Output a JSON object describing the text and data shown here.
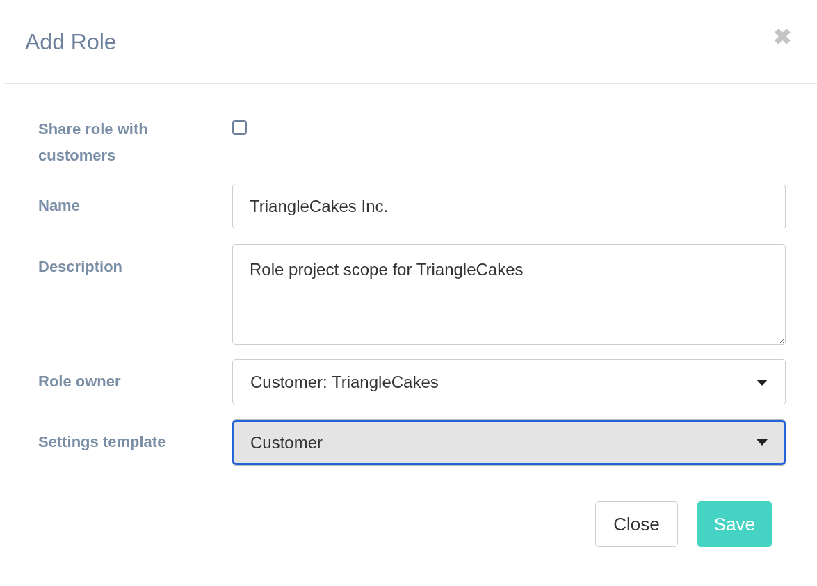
{
  "dialog": {
    "title": "Add Role",
    "close_icon": "✖"
  },
  "fields": [
    {
      "kind": "checkbox",
      "label": "Share role with customers",
      "checked": false
    },
    {
      "kind": "text",
      "label": "Name",
      "value": "TriangleCakes Inc."
    },
    {
      "kind": "textarea",
      "label": "Description",
      "value": "Role project scope for TriangleCakes"
    },
    {
      "kind": "select",
      "label": "Role owner",
      "value": "Customer: TriangleCakes",
      "focused": false
    },
    {
      "kind": "select",
      "label": "Settings template",
      "value": "Customer",
      "focused": true
    }
  ],
  "buttons": [
    {
      "kind": "default",
      "label": "Close"
    },
    {
      "kind": "primary",
      "label": "Save"
    }
  ]
}
